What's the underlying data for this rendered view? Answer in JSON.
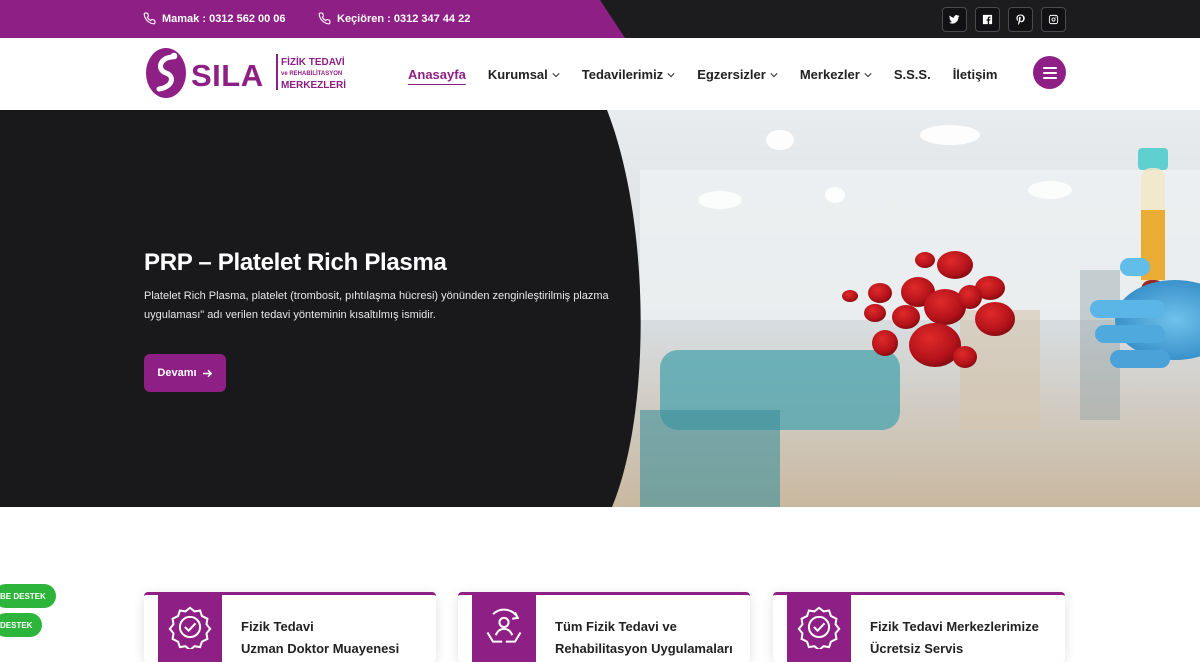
{
  "topbar": {
    "contacts": [
      {
        "text": "Mamak : 0312 562 00 06",
        "icon": "phone-icon"
      },
      {
        "text": "Keçiören : 0312 347 44 22",
        "icon": "phone-icon"
      }
    ],
    "socials": [
      "twitter-icon",
      "facebook-icon",
      "pinterest-icon",
      "instagram-icon"
    ]
  },
  "logo": {
    "name": "SILA",
    "line1": "FİZİK TEDAVİ",
    "line2": "ve REHABİLİTASYON",
    "line3": "MERKEZLERİ"
  },
  "menu": [
    {
      "label": "Anasayfa",
      "dropdown": false,
      "active": true
    },
    {
      "label": "Kurumsal",
      "dropdown": true
    },
    {
      "label": "Tedavilerimiz",
      "dropdown": true
    },
    {
      "label": "Egzersizler",
      "dropdown": true
    },
    {
      "label": "Merkezler",
      "dropdown": true
    },
    {
      "label": "S.S.S.",
      "dropdown": false
    },
    {
      "label": "İletişim",
      "dropdown": false
    }
  ],
  "hero": {
    "title": "PRP – Platelet Rich Plasma",
    "text": "Platelet Rich Plasma, platelet (trombosit, pıhtılaşma hücresi) yönünden zenginleştirilmiş plazma uygulaması\" adı verilen tedavi yönteminin kısaltılmış ismidir.",
    "button": "Devamı"
  },
  "cards": [
    {
      "line1": "Fizik Tedavi",
      "line2": "Uzman Doktor Muayenesi"
    },
    {
      "line1": "Tüm Fizik Tedavi ve",
      "line2": "Rehabilitasyon Uygulamaları"
    },
    {
      "line1": "Fizik Tedavi Merkezlerimize",
      "line2": "Ücretsiz Servis"
    }
  ],
  "support": [
    "BE DESTEK",
    "DESTEK"
  ],
  "colors": {
    "brand": "#8e1f84",
    "dark": "#1c1c1f",
    "support": "#2db53b"
  }
}
